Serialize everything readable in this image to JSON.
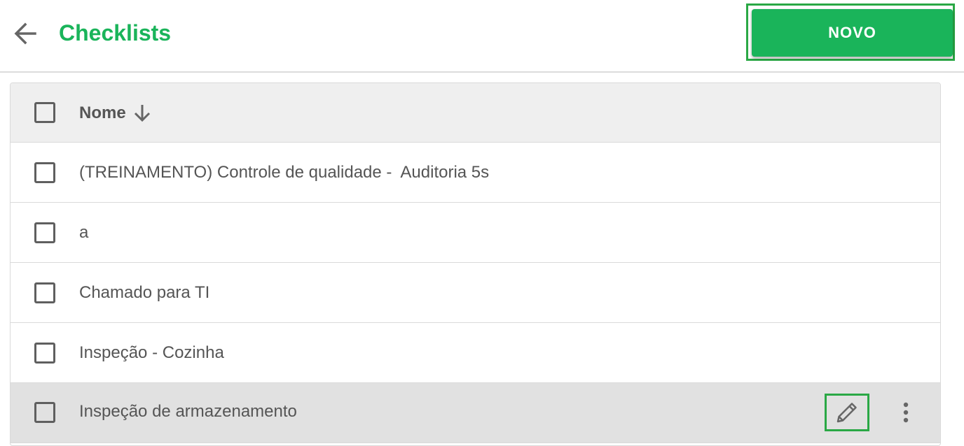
{
  "header": {
    "title": "Checklists",
    "new_button_label": "NOVO",
    "back_icon": "arrow-back-icon"
  },
  "table": {
    "column_header": "Nome",
    "sort_icon": "arrow-down-icon",
    "rows": [
      {
        "name": "(TREINAMENTO) Controle de qualidade -  Auditoria 5s"
      },
      {
        "name": "a"
      },
      {
        "name": "Chamado para TI"
      },
      {
        "name": "Inspeção - Cozinha"
      },
      {
        "name": "Inspeção de armazenamento"
      }
    ],
    "row_actions": {
      "edit_icon": "pencil-icon",
      "more_icon": "more-vert-icon"
    }
  },
  "colors": {
    "accent": "#1ab45a",
    "highlight_border": "#2aa845",
    "header_bg": "#efefef",
    "hover_row_bg": "#e1e1e1",
    "text": "#555555"
  }
}
